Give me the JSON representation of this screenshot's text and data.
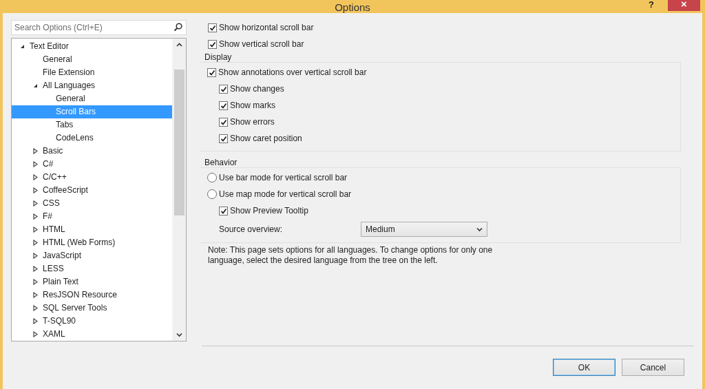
{
  "window": {
    "title": "Options",
    "help": "?",
    "close": "×"
  },
  "search": {
    "placeholder": "Search Options (Ctrl+E)"
  },
  "tree": [
    {
      "label": "Text Editor",
      "expanded": true,
      "selected": false,
      "children": [
        {
          "label": "General",
          "selected": false
        },
        {
          "label": "File Extension",
          "selected": false
        },
        {
          "label": "All Languages",
          "expanded": true,
          "selected": false,
          "children": [
            {
              "label": "General",
              "selected": false
            },
            {
              "label": "Scroll Bars",
              "selected": true
            },
            {
              "label": "Tabs",
              "selected": false
            },
            {
              "label": "CodeLens",
              "selected": false
            }
          ]
        },
        {
          "label": "Basic",
          "expanded": false,
          "selected": false
        },
        {
          "label": "C#",
          "expanded": false,
          "selected": false
        },
        {
          "label": "C/C++",
          "expanded": false,
          "selected": false
        },
        {
          "label": "CoffeeScript",
          "expanded": false,
          "selected": false
        },
        {
          "label": "CSS",
          "expanded": false,
          "selected": false
        },
        {
          "label": "F#",
          "expanded": false,
          "selected": false
        },
        {
          "label": "HTML",
          "expanded": false,
          "selected": false
        },
        {
          "label": "HTML (Web Forms)",
          "expanded": false,
          "selected": false
        },
        {
          "label": "JavaScript",
          "expanded": false,
          "selected": false
        },
        {
          "label": "LESS",
          "expanded": false,
          "selected": false
        },
        {
          "label": "Plain Text",
          "expanded": false,
          "selected": false
        },
        {
          "label": "ResJSON Resource",
          "expanded": false,
          "selected": false
        },
        {
          "label": "SQL Server Tools",
          "expanded": false,
          "selected": false
        },
        {
          "label": "T-SQL90",
          "expanded": false,
          "selected": false
        },
        {
          "label": "XAML",
          "expanded": false,
          "selected": false
        }
      ]
    }
  ],
  "options": [
    {
      "kind": "checkbox",
      "label": "Show horizontal scroll bar",
      "checked": true
    },
    {
      "kind": "checkbox",
      "label": "Show vertical scroll bar",
      "checked": true
    }
  ],
  "groups": [
    {
      "title": "Display",
      "options": [
        {
          "kind": "checkbox",
          "label": "Show annotations over vertical scroll bar",
          "checked": true,
          "children": [
            {
              "kind": "checkbox",
              "label": "Show changes",
              "checked": true
            },
            {
              "kind": "checkbox",
              "label": "Show marks",
              "checked": true
            },
            {
              "kind": "checkbox",
              "label": "Show errors",
              "checked": true
            },
            {
              "kind": "checkbox",
              "label": "Show caret position",
              "checked": true
            }
          ]
        }
      ]
    },
    {
      "title": "Behavior",
      "options": [
        {
          "kind": "radio",
          "label": "Use bar mode for vertical scroll bar",
          "selected": false
        },
        {
          "kind": "radio",
          "label": "Use map mode for vertical scroll bar",
          "selected": false,
          "children": [
            {
              "kind": "checkbox",
              "label": "Show Preview Tooltip",
              "checked": true
            },
            {
              "kind": "dropdown",
              "label": "Source overview:",
              "value": "Medium"
            }
          ]
        }
      ]
    }
  ],
  "note": "Note: This page sets options for all languages. To change options for only one language, select the desired language from the tree on the left.",
  "buttons": [
    {
      "label": "OK",
      "default": true
    },
    {
      "label": "Cancel",
      "default": false
    }
  ]
}
